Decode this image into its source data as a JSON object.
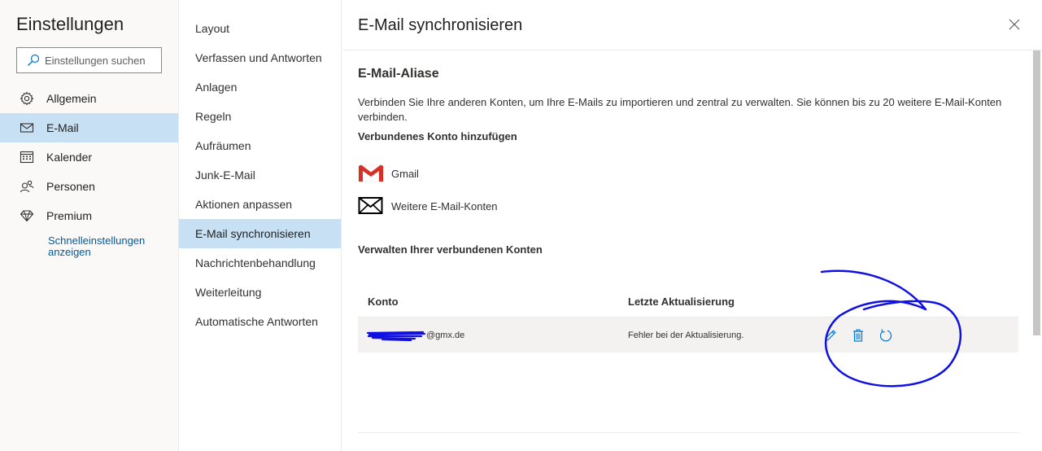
{
  "settings": {
    "title": "Einstellungen",
    "search_placeholder": "Einstellungen suchen",
    "nav": [
      {
        "label": "Allgemein",
        "icon": "gear-icon"
      },
      {
        "label": "E-Mail",
        "icon": "mail-icon",
        "selected": true
      },
      {
        "label": "Kalender",
        "icon": "calendar-icon"
      },
      {
        "label": "Personen",
        "icon": "people-icon"
      },
      {
        "label": "Premium",
        "icon": "diamond-icon"
      }
    ],
    "quick_settings_link": "Schnelleinstellungen anzeigen"
  },
  "mail_menu": {
    "items": [
      "Layout",
      "Verfassen und Antworten",
      "Anlagen",
      "Regeln",
      "Aufräumen",
      "Junk-E-Mail",
      "Aktionen anpassen",
      "E-Mail synchronisieren",
      "Nachrichtenbehandlung",
      "Weiterleitung",
      "Automatische Antworten"
    ],
    "selected": "E-Mail synchronisieren"
  },
  "pane": {
    "title": "E-Mail synchronisieren",
    "section_title": "E-Mail-Aliase",
    "description": "Verbinden Sie Ihre anderen Konten, um Ihre E-Mails zu importieren und zentral zu verwalten. Sie können bis zu 20 weitere E-Mail-Konten verbinden.",
    "add_account_title": "Verbundenes Konto hinzufügen",
    "providers": [
      {
        "label": "Gmail",
        "icon": "gmail-icon"
      },
      {
        "label": "Weitere E-Mail-Konten",
        "icon": "envelope-icon"
      }
    ],
    "manage_title": "Verwalten Ihrer verbundenen Konten",
    "table": {
      "headers": [
        "Konto",
        "Letzte Aktualisierung"
      ],
      "rows": [
        {
          "account": "@gmx.de",
          "status": "Fehler bei der Aktualisierung."
        }
      ]
    }
  },
  "colors": {
    "selected_bg": "#c7e0f4",
    "link": "#005a9e",
    "gmail_red": "#d93025",
    "annotation_blue": "#1010e0"
  }
}
